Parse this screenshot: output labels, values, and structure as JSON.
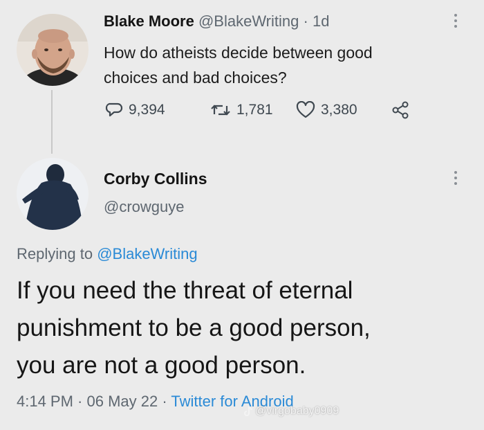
{
  "tweet": {
    "author_name": "Blake Moore",
    "author_handle": "@BlakeWriting",
    "separator": "·",
    "age": "1d",
    "text_line1": "How do atheists decide between good",
    "text_line2": "choices and bad choices?",
    "replies": "9,394",
    "retweets": "1,781",
    "likes": "3,380"
  },
  "reply": {
    "author_name": "Corby Collins",
    "author_handle": "@crowguye",
    "replying_prefix": "Replying to ",
    "replying_to": "@BlakeWriting",
    "text_line1": "If you need the threat of eternal",
    "text_line2": "punishment to be a good person,",
    "text_line3": "you are not a good person.",
    "time": "4:14 PM",
    "dot1": " · ",
    "date": "06 May 22",
    "dot2": " · ",
    "client": "Twitter for Android"
  },
  "watermark": {
    "text": "@virgobaby0909",
    "icon": "tiktok-icon"
  },
  "colors": {
    "background": "#ebebeb",
    "link": "#2a8ad6",
    "muted": "#5e6770"
  }
}
